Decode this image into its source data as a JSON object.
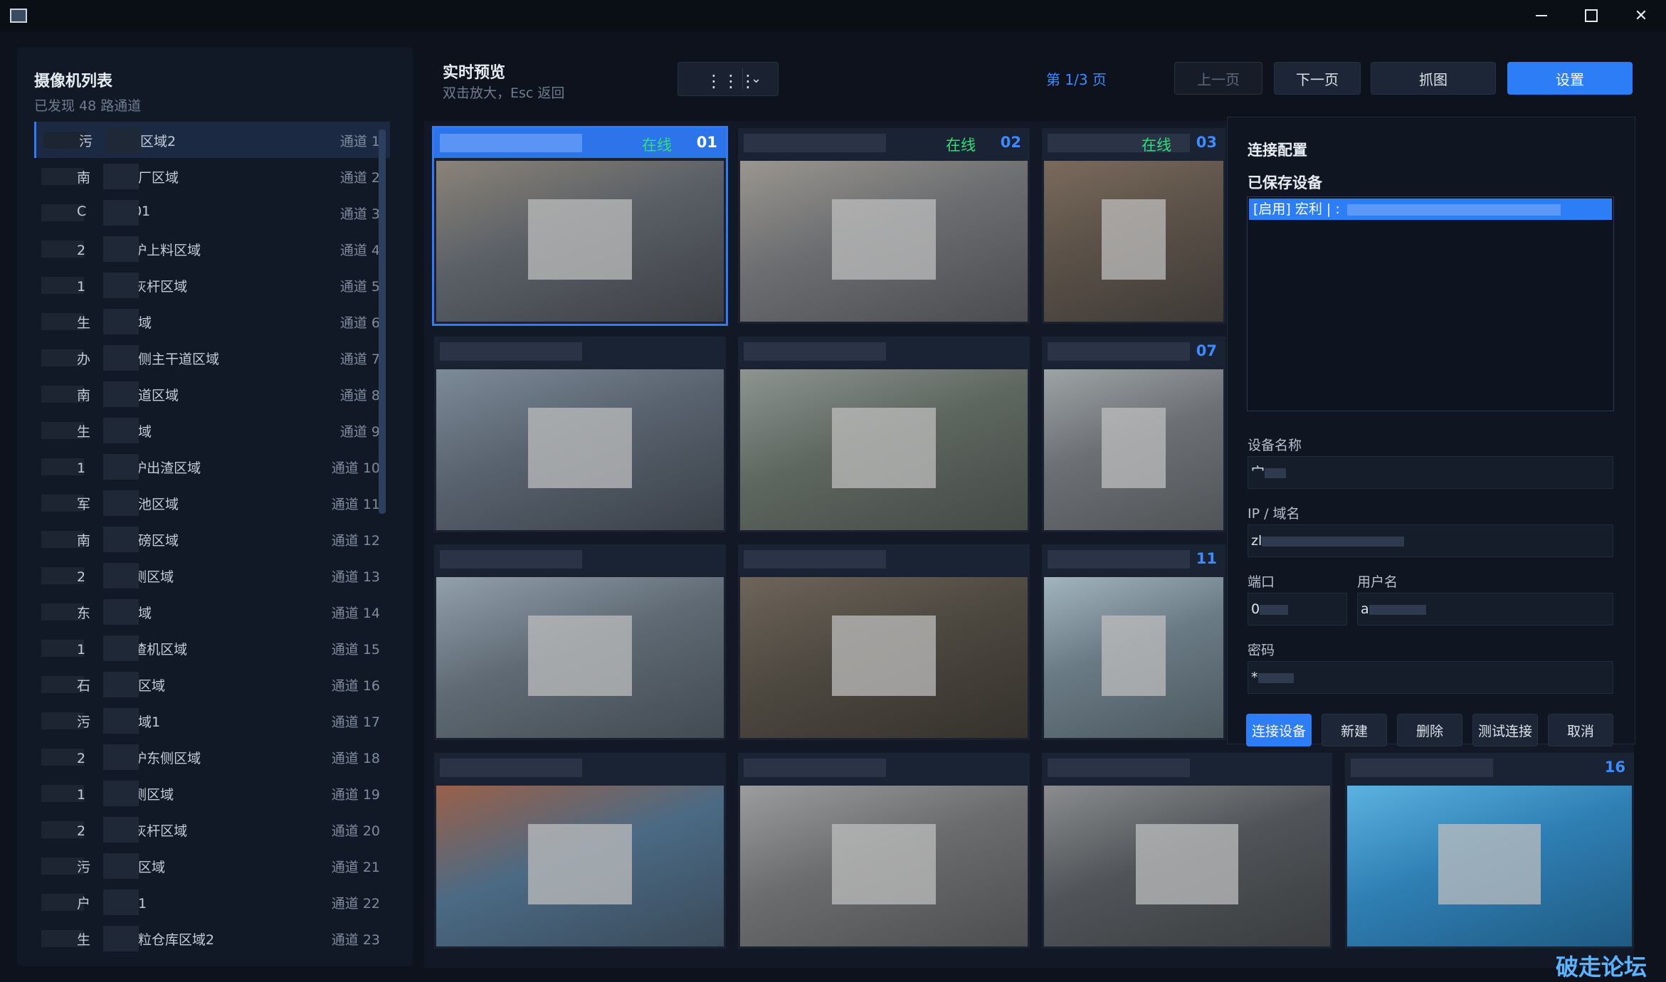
{
  "window": {
    "minimize_symbol": "—",
    "close_symbol": "✕"
  },
  "sidebar": {
    "title": "摄像机列表",
    "subtitle": "已发现 48 路通道",
    "cameras": [
      {
        "name": "污",
        "name2": "贱区域2",
        "channel": "通道 1"
      },
      {
        "name": "南",
        "name2": "生厂区域",
        "channel": "通道 2"
      },
      {
        "name": "C",
        "name2": "a 01",
        "channel": "通道 3"
      },
      {
        "name": "2",
        "name2": "锅炉上料区域",
        "channel": "通道 4"
      },
      {
        "name": "1",
        "name2": "拉灰杆区域",
        "channel": "通道 5"
      },
      {
        "name": "生",
        "name2": "区域",
        "channel": "通道 6"
      },
      {
        "name": "办",
        "name2": "东侧主干道区域",
        "channel": "通道 7"
      },
      {
        "name": "南",
        "name2": "干道区域",
        "channel": "通道 8"
      },
      {
        "name": "生",
        "name2": "区域",
        "channel": "通道 9"
      },
      {
        "name": "1",
        "name2": "锅炉出渣区域",
        "channel": "通道 10"
      },
      {
        "name": "军",
        "name2": "沉池区域",
        "channel": "通道 11"
      },
      {
        "name": "南",
        "name2": "地磅区域",
        "channel": "通道 12"
      },
      {
        "name": "2",
        "name2": "西侧区域",
        "channel": "通道 13"
      },
      {
        "name": "东",
        "name2": "区域",
        "channel": "通道 14"
      },
      {
        "name": "1",
        "name2": "出渣机区域",
        "channel": "通道 15"
      },
      {
        "name": "石",
        "name2": "故区域",
        "channel": "通道 16"
      },
      {
        "name": "污",
        "name2": "区域1",
        "channel": "通道 17"
      },
      {
        "name": "2",
        "name2": "锅炉东侧区域",
        "channel": "通道 18"
      },
      {
        "name": "1",
        "name2": "东侧区域",
        "channel": "通道 19"
      },
      {
        "name": "2",
        "name2": "拉灰杆区域",
        "channel": "通道 20"
      },
      {
        "name": "污",
        "name2": "贱区域",
        "channel": "通道 21"
      },
      {
        "name": "户",
        "name2": "间1",
        "channel": "通道 22"
      },
      {
        "name": "生",
        "name2": "颗粒仓库区域2",
        "channel": "通道 23"
      }
    ]
  },
  "header": {
    "title": "实时预览",
    "subtitle": "双击放大，Esc 返回",
    "grid_icon": "⋮⋮⋮",
    "chevron": "⌄",
    "page_indicator": "第 1/3 页",
    "prev_label": "上一页",
    "next_label": "下一页",
    "snapshot_label": "抓图",
    "settings_label": "设置"
  },
  "tiles": [
    {
      "status": "在线",
      "num": "01"
    },
    {
      "status": "在线",
      "num": "02"
    },
    {
      "status": "在线",
      "num": "03"
    },
    {
      "status": "",
      "num": ""
    },
    {
      "status": "",
      "num": ""
    },
    {
      "status": "",
      "num": "07"
    },
    {
      "status": "",
      "num": ""
    },
    {
      "status": "",
      "num": ""
    },
    {
      "status": "",
      "num": "11"
    },
    {
      "status": "",
      "num": ""
    },
    {
      "status": "",
      "num": ""
    },
    {
      "status": "",
      "num": ""
    },
    {
      "status": "",
      "num": "16"
    }
  ],
  "settings": {
    "title": "连接配置",
    "saved_title": "已保存设备",
    "saved_device": "[启用] 宏利 | :",
    "device_name_label": "设备名称",
    "device_name_value": "宀",
    "ip_label": "IP / 域名",
    "ip_value": "zl",
    "port_label": "端口",
    "port_value": "0",
    "user_label": "用户名",
    "user_value": "a",
    "password_label": "密码",
    "password_value": "*",
    "connect_label": "连接设备",
    "new_label": "新建",
    "delete_label": "删除",
    "test_label": "测试连接",
    "cancel_label": "取消"
  },
  "watermark": "破走论坛",
  "colors": {
    "accent": "#2c7df6",
    "online": "#2fe07a",
    "background": "#0d121c"
  }
}
